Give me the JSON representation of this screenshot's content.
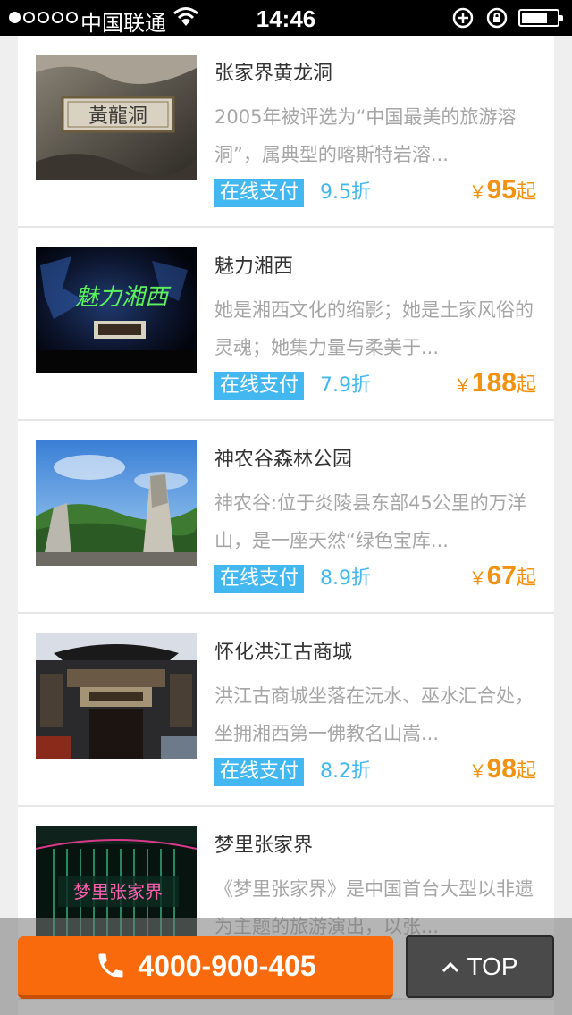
{
  "status_bar": {
    "carrier": "中国联通",
    "time": "14:46"
  },
  "scenic_spots": [
    {
      "name": "张家界黄龙洞",
      "description": "2005年被评选为“中国最美的旅游溶洞”，属典型的喀斯特岩溶...",
      "pay_label": "在线支付",
      "discount": "9.5折",
      "currency": "￥",
      "price": "95",
      "price_suffix": "起",
      "thumb_text": "黃龍洞"
    },
    {
      "name": "魅力湘西",
      "description": "她是湘西文化的缩影；她是土家风俗的灵魂；她集力量与柔美于...",
      "pay_label": "在线支付",
      "discount": "7.9折",
      "currency": "￥",
      "price": "188",
      "price_suffix": "起",
      "thumb_text": "魅力湘西"
    },
    {
      "name": "神农谷森林公园",
      "description": "神农谷:位于炎陵县东部45公里的万洋山，是一座天然“绿色宝库...",
      "pay_label": "在线支付",
      "discount": "8.9折",
      "currency": "￥",
      "price": "67",
      "price_suffix": "起"
    },
    {
      "name": "怀化洪江古商城",
      "description": "洪江古商城坐落在沅水、巫水汇合处，坐拥湘西第一佛教名山嵩...",
      "pay_label": "在线支付",
      "discount": "8.2折",
      "currency": "￥",
      "price": "98",
      "price_suffix": "起"
    },
    {
      "name": "梦里张家界",
      "description": "《梦里张家界》是中国首台大型以非遗为主题的旅游演出，以张...",
      "thumb_text": "梦里张家界"
    }
  ],
  "footer": {
    "phone": "4000-900-405",
    "top_label": "TOP"
  },
  "colors": {
    "accent_blue": "#43b7ef",
    "price_orange": "#f39110",
    "call_orange": "#f86a0b"
  },
  "icons": [
    "wifi-icon",
    "rotation-lock-icon",
    "alarm-icon",
    "battery-icon",
    "phone-icon",
    "chevron-up-icon"
  ]
}
